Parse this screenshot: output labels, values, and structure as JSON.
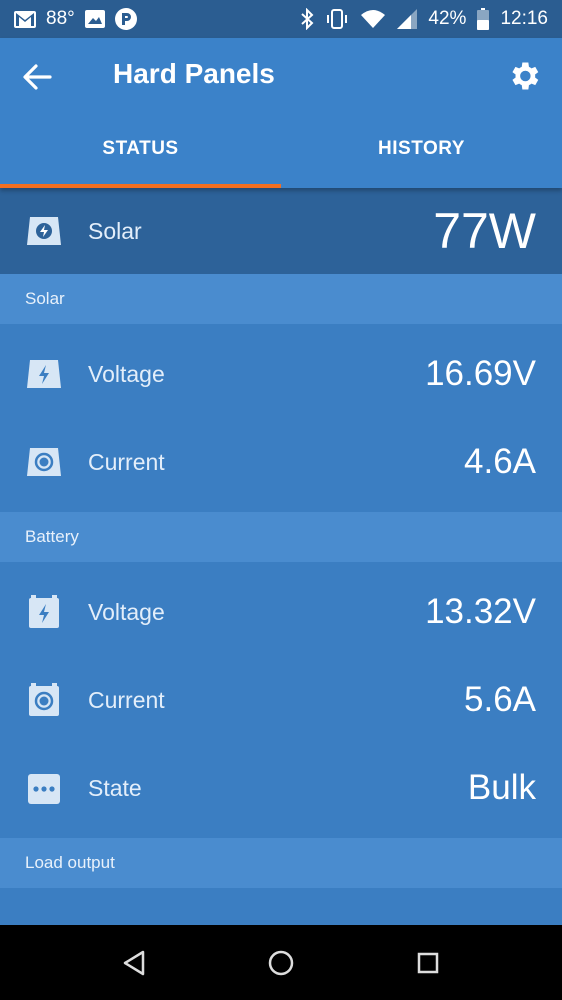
{
  "status_bar": {
    "temperature": "88°",
    "battery_percent": "42%",
    "time": "12:16"
  },
  "app_bar": {
    "title": "Hard Panels",
    "tabs": [
      {
        "label": "STATUS",
        "active": true
      },
      {
        "label": "HISTORY",
        "active": false
      }
    ]
  },
  "summary": {
    "label": "Solar",
    "value": "77W"
  },
  "sections": {
    "solar": {
      "header": "Solar",
      "rows": [
        {
          "label": "Voltage",
          "value": "16.69V",
          "icon": "solar-voltage-icon"
        },
        {
          "label": "Current",
          "value": "4.6A",
          "icon": "solar-current-icon"
        }
      ]
    },
    "battery": {
      "header": "Battery",
      "rows": [
        {
          "label": "Voltage",
          "value": "13.32V",
          "icon": "battery-voltage-icon"
        },
        {
          "label": "Current",
          "value": "5.6A",
          "icon": "battery-current-icon"
        },
        {
          "label": "State",
          "value": "Bulk",
          "icon": "state-dots-icon"
        }
      ]
    },
    "load": {
      "header": "Load output"
    }
  },
  "colors": {
    "app_bar": "#3b82c9",
    "status_bar": "#2b5d91",
    "hero_band": "#2d6299",
    "content": "#3b7ec2",
    "section_header": "#4a8ccf",
    "tab_indicator": "#f36f21"
  }
}
